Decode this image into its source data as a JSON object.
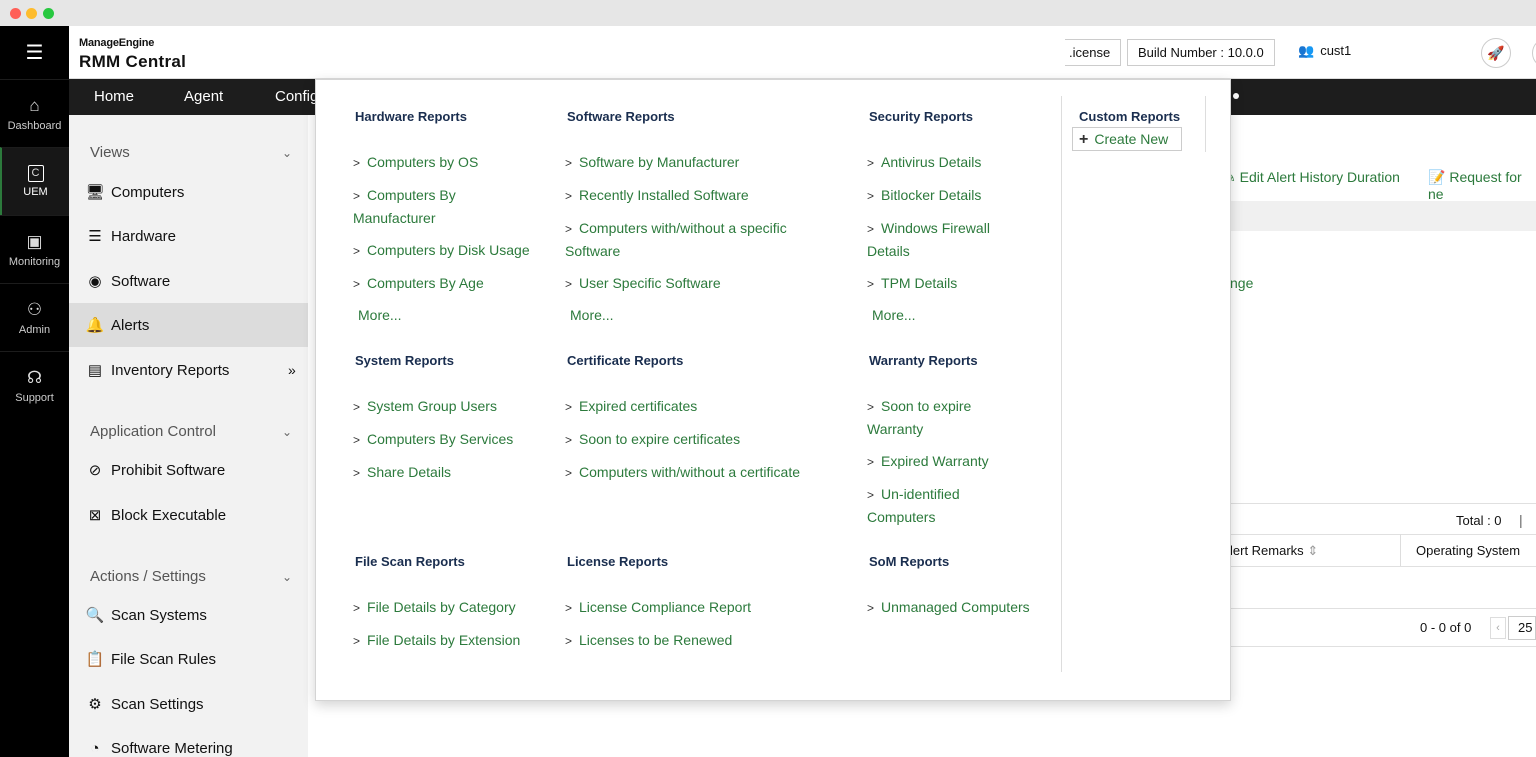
{
  "rail": {
    "items": [
      {
        "label": "Dashboard"
      },
      {
        "label": "UEM"
      },
      {
        "label": "Monitoring"
      },
      {
        "label": "Admin"
      },
      {
        "label": "Support"
      }
    ]
  },
  "header": {
    "brand_top": "ManageEngine",
    "brand_main": "RMM Central",
    "license_label": ".icense",
    "build_label": "Build Number : 10.0.0",
    "user": "cust1"
  },
  "topnav": {
    "items": [
      "Home",
      "Agent",
      "Config"
    ]
  },
  "side": {
    "views_label": "Views",
    "views_items": [
      "Computers",
      "Hardware",
      "Software",
      "Alerts",
      "Inventory Reports"
    ],
    "appcontrol_label": "Application Control",
    "appcontrol_items": [
      "Prohibit Software",
      "Block Executable"
    ],
    "actions_label": "Actions / Settings",
    "actions_items": [
      "Scan Systems",
      "File Scan Rules",
      "Scan Settings",
      "Software Metering"
    ]
  },
  "background": {
    "edit_alert": "Edit Alert History Duration",
    "request": "Request for ne",
    "nge": "nge",
    "total": "Total : 0",
    "remarks": "lert Remarks",
    "os": "Operating System",
    "range": "0 - 0 of 0",
    "page_size": "25"
  },
  "dropdown": {
    "hardware": {
      "title": "Hardware Reports",
      "links": [
        "Computers by OS",
        "Computers By Manufacturer",
        "Computers by Disk Usage",
        "Computers By Age"
      ],
      "more": "More..."
    },
    "software": {
      "title": "Software Reports",
      "links": [
        "Software by Manufacturer",
        "Recently Installed Software",
        "Computers with/without a specific Software",
        "User Specific Software"
      ],
      "more": "More..."
    },
    "security": {
      "title": "Security Reports",
      "links": [
        "Antivirus Details",
        "Bitlocker Details",
        "Windows Firewall Details",
        "TPM Details"
      ],
      "more": "More..."
    },
    "custom": {
      "title": "Custom Reports",
      "create": "Create New"
    },
    "system": {
      "title": "System Reports",
      "links": [
        "System Group Users",
        "Computers By Services",
        "Share Details"
      ]
    },
    "certificate": {
      "title": "Certificate Reports",
      "links": [
        "Expired certificates",
        "Soon to expire certificates",
        "Computers with/without a certificate"
      ]
    },
    "warranty": {
      "title": "Warranty Reports",
      "links": [
        "Soon to expire Warranty",
        "Expired Warranty",
        "Un-identified Computers"
      ]
    },
    "filescan": {
      "title": "File Scan Reports",
      "links": [
        "File Details by Category",
        "File Details by Extension"
      ]
    },
    "license": {
      "title": "License Reports",
      "links": [
        "License Compliance Report",
        "Licenses to be Renewed"
      ]
    },
    "som": {
      "title": "SoM Reports",
      "links": [
        "Unmanaged Computers"
      ]
    }
  }
}
